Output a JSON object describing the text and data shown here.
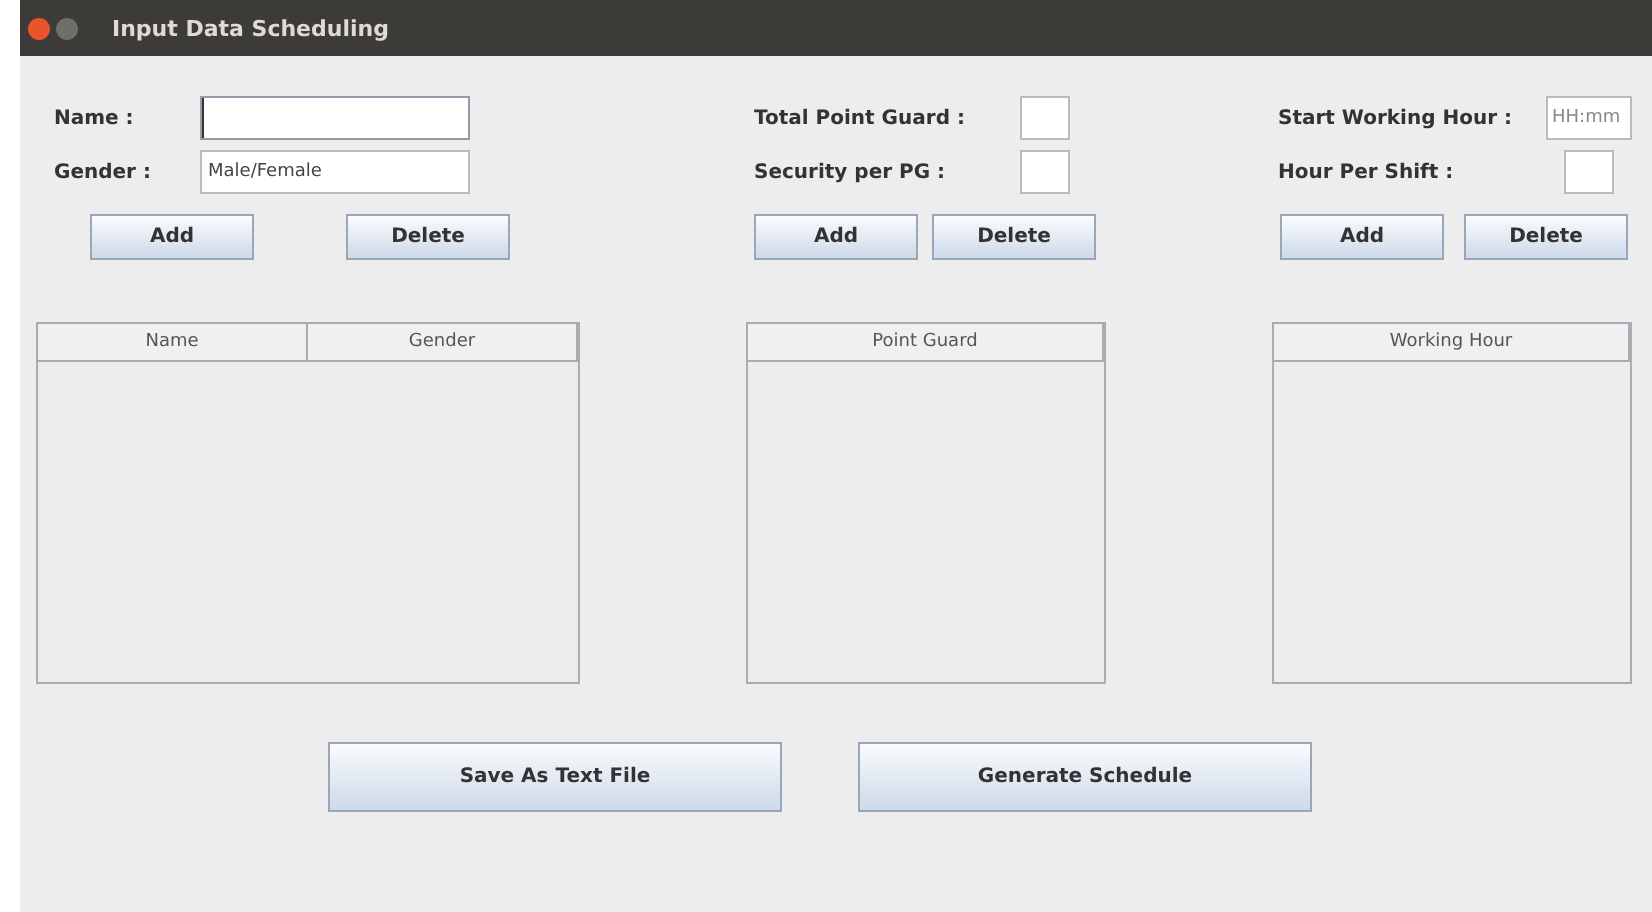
{
  "window": {
    "title": "Input Data Scheduling"
  },
  "sections": [
    {
      "fields": [
        {
          "label": "Name :",
          "focused": true,
          "kind": "wide"
        },
        {
          "label": "Gender :",
          "value": "Male/Female",
          "focused": false,
          "kind": "wide"
        }
      ],
      "buttons": [
        "Add",
        "Delete"
      ],
      "table": {
        "columns": [
          "Name",
          "Gender"
        ]
      }
    },
    {
      "fields": [
        {
          "label": "Total Point Guard :",
          "focused": false,
          "kind": "short"
        },
        {
          "label": "Security per PG :",
          "focused": false,
          "kind": "short"
        }
      ],
      "buttons": [
        "Add",
        "Delete"
      ],
      "table": {
        "columns": [
          "Point Guard"
        ]
      }
    },
    {
      "fields": [
        {
          "label": "Start Working Hour :",
          "placeholder": "HH:mm",
          "focused": false,
          "kind": "time"
        },
        {
          "label": "Hour Per Shift :",
          "focused": false,
          "kind": "short"
        }
      ],
      "buttons": [
        "Add",
        "Delete"
      ],
      "table": {
        "columns": [
          "Working Hour"
        ]
      }
    }
  ],
  "actions": [
    "Save As Text File",
    "Generate Schedule"
  ]
}
